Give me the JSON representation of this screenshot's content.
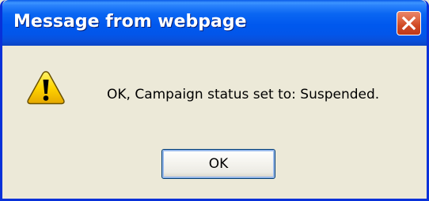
{
  "dialog": {
    "title": "Message from webpage",
    "message": "OK, Campaign status set to: Suspended.",
    "icon": "warning-icon",
    "close_icon": "close-icon",
    "ok_label": "OK"
  },
  "colors": {
    "titlebar": "#0058ee",
    "window_border": "#0831d9",
    "body_bg": "#ece9d8",
    "close_button": "#d04a25",
    "warning_yellow": "#ffd400"
  }
}
